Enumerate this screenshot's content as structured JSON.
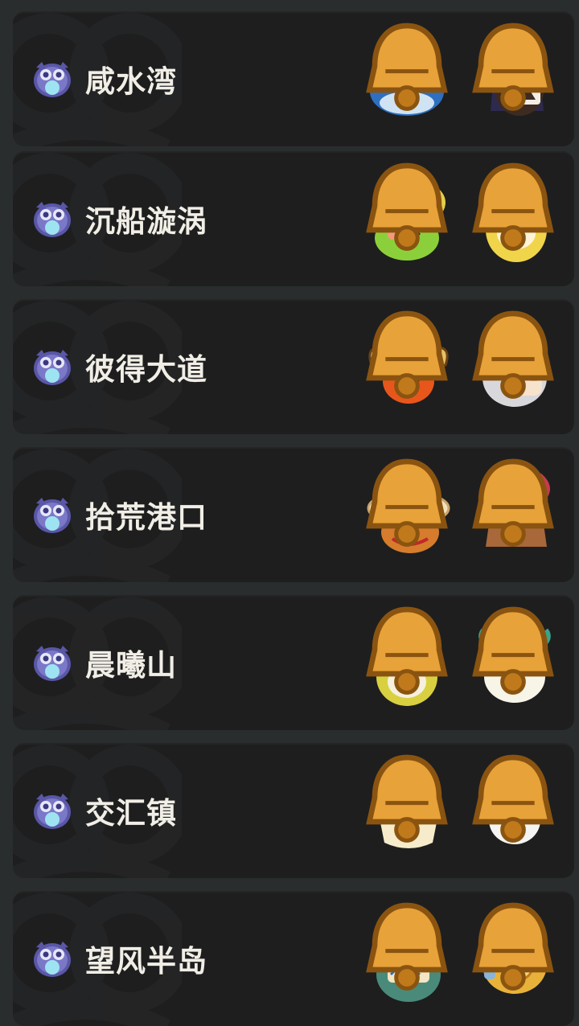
{
  "regions": [
    {
      "name": "咸水湾",
      "pets": [
        "blue-crystal-whale-pet-icon",
        "hooded-hourglass-pet-icon"
      ]
    },
    {
      "name": "沉船漩涡",
      "pets": [
        "green-slime-pet-icon",
        "yellow-sprout-pet-icon"
      ]
    },
    {
      "name": "彼得大道",
      "pets": [
        "fire-horned-pet-icon",
        "white-hair-pet-icon"
      ]
    },
    {
      "name": "拾荒港口",
      "pets": [
        "straw-hat-pet-icon",
        "red-horn-rock-pet-icon"
      ]
    },
    {
      "name": "晨曦山",
      "pets": [
        "flower-seed-pet-icon",
        "antler-bird-pet-icon"
      ]
    },
    {
      "name": "交汇镇",
      "pets": [
        "yellow-chick-pet-icon",
        "white-bird-pet-icon"
      ]
    },
    {
      "name": "望风半岛",
      "pets": [
        "robot-pod-pet-icon",
        "gear-robot-pet-icon"
      ]
    }
  ],
  "colors": {
    "background": "#2a2d2e",
    "card": "#1e1e1f",
    "text": "#f1eee6",
    "badge": "#4a4a9a",
    "bell": "#e8a23a"
  }
}
